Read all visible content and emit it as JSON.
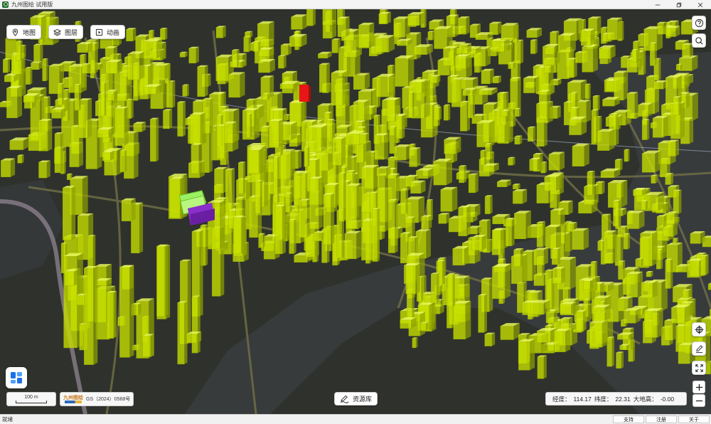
{
  "window": {
    "title": "九州图绘 试用版"
  },
  "toolbar": {
    "map_label": "地图",
    "layers_label": "图层",
    "animation_label": "动画"
  },
  "right_tools": {
    "help_icon": "help-circle-icon",
    "search_icon": "search-icon",
    "locate_icon": "crosshair-globe-icon",
    "draw_icon": "pen-draw-icon",
    "fullscreen_icon": "expand-icon"
  },
  "map": {
    "scale_label": "100 m",
    "logo_text": "九州图绘",
    "gs_number": "GS（2024）0568号",
    "building_color": "#c8e000",
    "highlight_red": "#e81616",
    "highlight_purple": "#8a2fc9",
    "highlight_green": "#9bf064"
  },
  "resource": {
    "label": "资源库"
  },
  "coords": {
    "lon_label": "经度：",
    "lon_value": "114.17",
    "lat_label": "纬度：",
    "lat_value": "22.31",
    "alt_label": "大地高：",
    "alt_value": "-0.00"
  },
  "zoom": {
    "in_label": "+",
    "out_label": "−"
  },
  "status": {
    "text": "就绪",
    "btn_support": "支持",
    "btn_register": "注册",
    "btn_about": "关于"
  }
}
